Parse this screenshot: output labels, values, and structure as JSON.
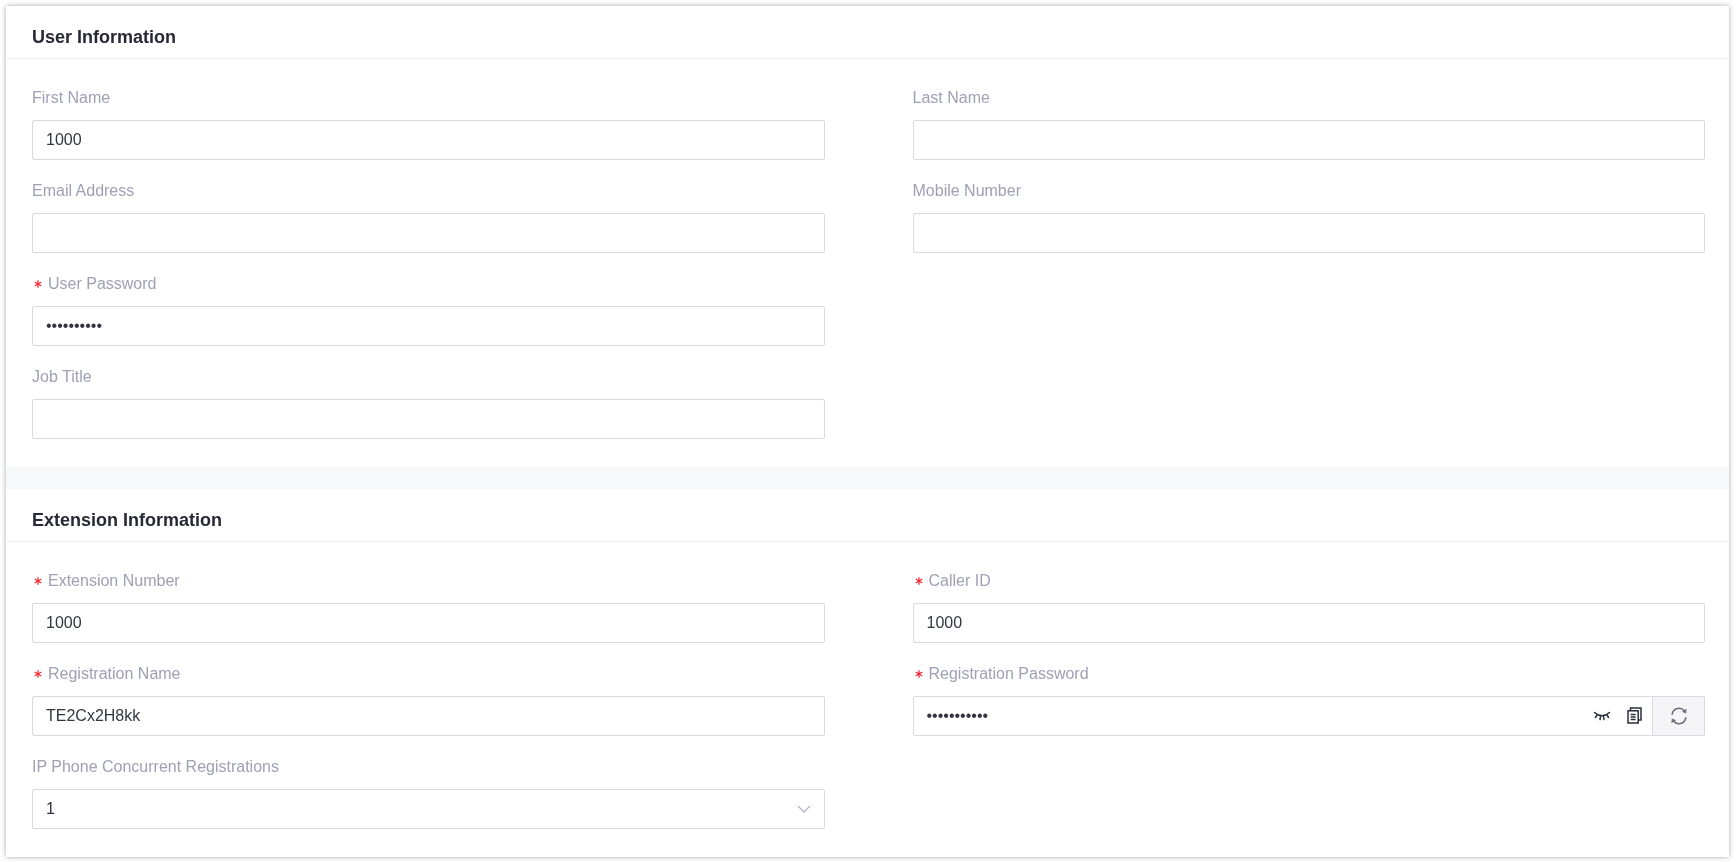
{
  "sections": [
    {
      "title": "User Information",
      "rows": [
        [
          {
            "label": "First Name",
            "required": false,
            "kind": "text",
            "value": "1000"
          },
          {
            "label": "Last Name",
            "required": false,
            "kind": "text"
          }
        ],
        [
          {
            "label": "Email Address",
            "required": false,
            "kind": "text"
          },
          {
            "label": "Mobile Number",
            "required": false,
            "kind": "text"
          }
        ],
        [
          {
            "label": "User Password",
            "required": true,
            "kind": "text",
            "value": "••••••••••"
          }
        ],
        [
          {
            "label": "Job Title",
            "required": false,
            "kind": "text"
          }
        ]
      ]
    },
    {
      "title": "Extension Information",
      "rows": [
        [
          {
            "label": "Extension Number",
            "required": true,
            "kind": "text",
            "value": "1000"
          },
          {
            "label": "Caller ID",
            "required": true,
            "kind": "text",
            "value": "1000"
          }
        ],
        [
          {
            "label": "Registration Name",
            "required": true,
            "kind": "text",
            "value": "TE2Cx2H8kk"
          },
          {
            "label": "Registration Password",
            "required": true,
            "kind": "secret",
            "value": "•••••••••••"
          }
        ],
        [
          {
            "label": "IP Phone Concurrent Registrations",
            "required": false,
            "kind": "select",
            "value": "1"
          }
        ]
      ]
    }
  ]
}
